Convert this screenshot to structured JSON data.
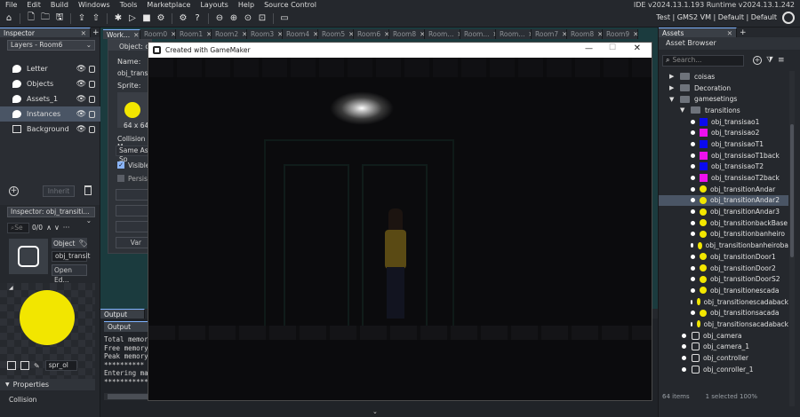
{
  "menu": [
    "File",
    "Edit",
    "Build",
    "Windows",
    "Tools",
    "Marketplace",
    "Layouts",
    "Help",
    "Source Control"
  ],
  "ide_version": "IDE v2024.13.1.193  Runtime v2024.13.1.242",
  "targets": "Test | GMS2 VM | Default | Default",
  "toolbar_icons": [
    "home-icon",
    "new-icon",
    "open-icon",
    "save-icon",
    "package-icon",
    "upload-icon",
    "clean-icon",
    "run-icon",
    "stop-icon",
    "debug-icon",
    "settings-icon",
    "help-icon",
    "zoom-out-icon",
    "zoom-in-icon",
    "zoom-reset-icon",
    "fit-icon",
    "monitor-icon"
  ],
  "inspector": {
    "tab": "Inspector",
    "layers_select": "Layers - Room6",
    "layers": [
      {
        "name": "Letter",
        "icon": "instance-layer-icon"
      },
      {
        "name": "Objects",
        "icon": "instance-layer-icon"
      },
      {
        "name": "Assets_1",
        "icon": "asset-layer-icon"
      },
      {
        "name": "Instances",
        "icon": "instance-layer-icon",
        "selected": true
      },
      {
        "name": "Background",
        "icon": "background-layer-icon"
      }
    ],
    "inherit_label": "Inherit",
    "inspector2_select": "Inspector: obj_transiti...",
    "search_placeholder": "Se",
    "count": "0/0",
    "object_label": "Object",
    "object_name": "obj_transit",
    "open_editor": "Open Ed...",
    "sprite_name": "spr_ol",
    "properties_label": "Properties",
    "collision_label": "Collision"
  },
  "workspace": {
    "tabs": [
      "Work...",
      "Room0",
      "Room1",
      "Room2",
      "Room3",
      "Room4",
      "Room5",
      "Room6",
      "Room8",
      "Room...",
      "Room...",
      "Room...",
      "Room7",
      "Room8",
      "Room9"
    ],
    "object_header": "Object: ol",
    "name_label": "Name:",
    "name_value": "obj_transit",
    "sprite_label": "Sprite:",
    "sprite_size": "64 x 64",
    "collision_mask_label": "Collision M",
    "collision_mask_value": "Same As Sp",
    "visible_label": "Visible",
    "persistent_label": "Persiste",
    "var_button": "Var"
  },
  "output": {
    "outer_tab": "Output",
    "inner_tab": "Output",
    "lines": [
      "Total memory",
      "Free memory",
      "Peak memory",
      "**********",
      "Entering mai",
      "************************************."
    ]
  },
  "game_window": {
    "title": "Created with GameMaker"
  },
  "assets": {
    "tab": "Assets",
    "header": "Asset Browser",
    "search_placeholder": "Search...",
    "tree": [
      {
        "label": "coisas",
        "kind": "folder",
        "indent": 0,
        "expand": "▶"
      },
      {
        "label": "Decoration",
        "kind": "folder",
        "indent": 0,
        "expand": "▶"
      },
      {
        "label": "gamesetings",
        "kind": "folder",
        "indent": 0,
        "expand": "▼"
      },
      {
        "label": "transitions",
        "kind": "folder",
        "indent": 1,
        "expand": "▼"
      },
      {
        "label": "obj_transisao1",
        "kind": "square",
        "color": "#0a0aee",
        "indent": 2
      },
      {
        "label": "obj_transisao2",
        "kind": "square",
        "color": "#ee10ee",
        "indent": 2
      },
      {
        "label": "obj_transisaoT1",
        "kind": "square",
        "color": "#0a0aee",
        "indent": 2
      },
      {
        "label": "obj_transisaoT1back",
        "kind": "square",
        "color": "#ee10ee",
        "indent": 2
      },
      {
        "label": "obj_transisaoT2",
        "kind": "square",
        "color": "#0a0aee",
        "indent": 2
      },
      {
        "label": "obj_transisaoT2back",
        "kind": "square",
        "color": "#ee10ee",
        "indent": 2
      },
      {
        "label": "obj_transitionAndar",
        "kind": "circle",
        "indent": 2
      },
      {
        "label": "obj_transitionAndar2",
        "kind": "circle",
        "indent": 2,
        "selected": true
      },
      {
        "label": "obj_transitionAndar3",
        "kind": "circle",
        "indent": 2
      },
      {
        "label": "obj_transitionbackBase",
        "kind": "circle",
        "indent": 2
      },
      {
        "label": "obj_transitionbanheiro",
        "kind": "circle",
        "indent": 2
      },
      {
        "label": "obj_transitionbanheiroba",
        "kind": "circle",
        "indent": 2
      },
      {
        "label": "obj_transitionDoor1",
        "kind": "circle",
        "indent": 2
      },
      {
        "label": "obj_transitionDoor2",
        "kind": "circle",
        "indent": 2
      },
      {
        "label": "obj_transitionDoorS2",
        "kind": "circle",
        "indent": 2
      },
      {
        "label": "obj_transitionescada",
        "kind": "circle",
        "indent": 2
      },
      {
        "label": "obj_transitionescadaback",
        "kind": "circle",
        "indent": 2
      },
      {
        "label": "obj_transitionsacada",
        "kind": "circle",
        "indent": 2
      },
      {
        "label": "obj_transitionsacadaback",
        "kind": "circle",
        "indent": 2
      },
      {
        "label": "obj_camera",
        "kind": "object",
        "indent": 0
      },
      {
        "label": "obj_camera_1",
        "kind": "object",
        "indent": 0
      },
      {
        "label": "obj_controller",
        "kind": "object",
        "indent": 0
      },
      {
        "label": "obj_conroller_1",
        "kind": "object",
        "indent": 0
      }
    ],
    "footer_count": "64 items",
    "footer_selected": "1 selected 100%"
  },
  "colors": {
    "accent": "#7fb3ff",
    "selection": "#4a5565",
    "yellow": "#f2e600",
    "progress": "#1ea01e"
  }
}
